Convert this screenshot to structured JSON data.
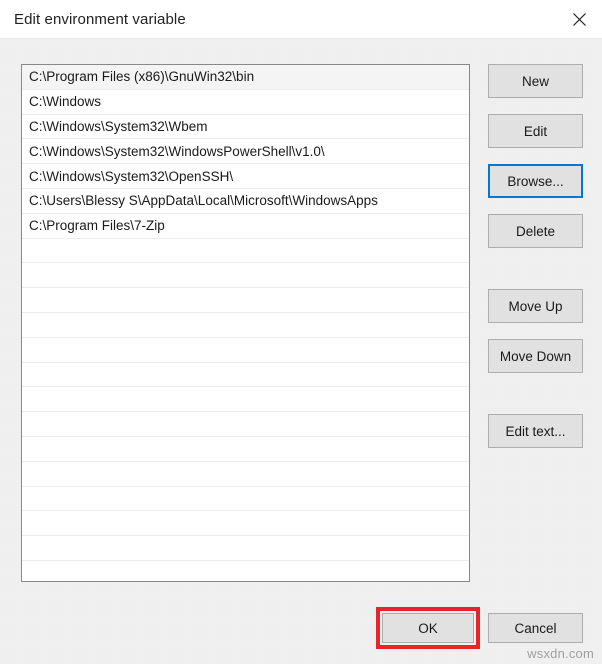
{
  "window": {
    "title": "Edit environment variable",
    "close_icon": "close-icon"
  },
  "colors": {
    "dialog_background": "#f0f0f0",
    "titlebar_background": "#ffffff",
    "listbox_background": "#ffffff",
    "listbox_border": "#888888",
    "row_selected_background": "#f4f4f4",
    "row_separator": "#ededed",
    "button_face": "#e1e1e1",
    "button_border": "#adadad",
    "focus_border": "#0078d7",
    "annotation_red": "#e8242a",
    "text": "#1a1a1a",
    "watermark_text": "#a0a0a0"
  },
  "listbox": {
    "selected_index": 0,
    "entries": [
      "C:\\Program Files (x86)\\GnuWin32\\bin",
      "C:\\Windows",
      "C:\\Windows\\System32\\Wbem",
      "C:\\Windows\\System32\\WindowsPowerShell\\v1.0\\",
      "C:\\Windows\\System32\\OpenSSH\\",
      "C:\\Users\\Blessy S\\AppData\\Local\\Microsoft\\WindowsApps",
      "C:\\Program Files\\7-Zip"
    ],
    "empty_row_count": 14
  },
  "side_buttons": [
    {
      "id": "new",
      "label": "New",
      "focused": false
    },
    {
      "id": "edit",
      "label": "Edit",
      "focused": false
    },
    {
      "id": "browse",
      "label": "Browse...",
      "focused": true
    },
    {
      "id": "delete",
      "label": "Delete",
      "focused": false
    },
    {
      "id": "move_up",
      "label": "Move Up",
      "focused": false
    },
    {
      "id": "move_down",
      "label": "Move Down",
      "focused": false
    },
    {
      "id": "edit_text",
      "label": "Edit text...",
      "focused": false
    }
  ],
  "footer": {
    "ok_label": "OK",
    "cancel_label": "Cancel",
    "ok_highlighted": true
  },
  "watermark": {
    "text": "wsxdn.com"
  }
}
